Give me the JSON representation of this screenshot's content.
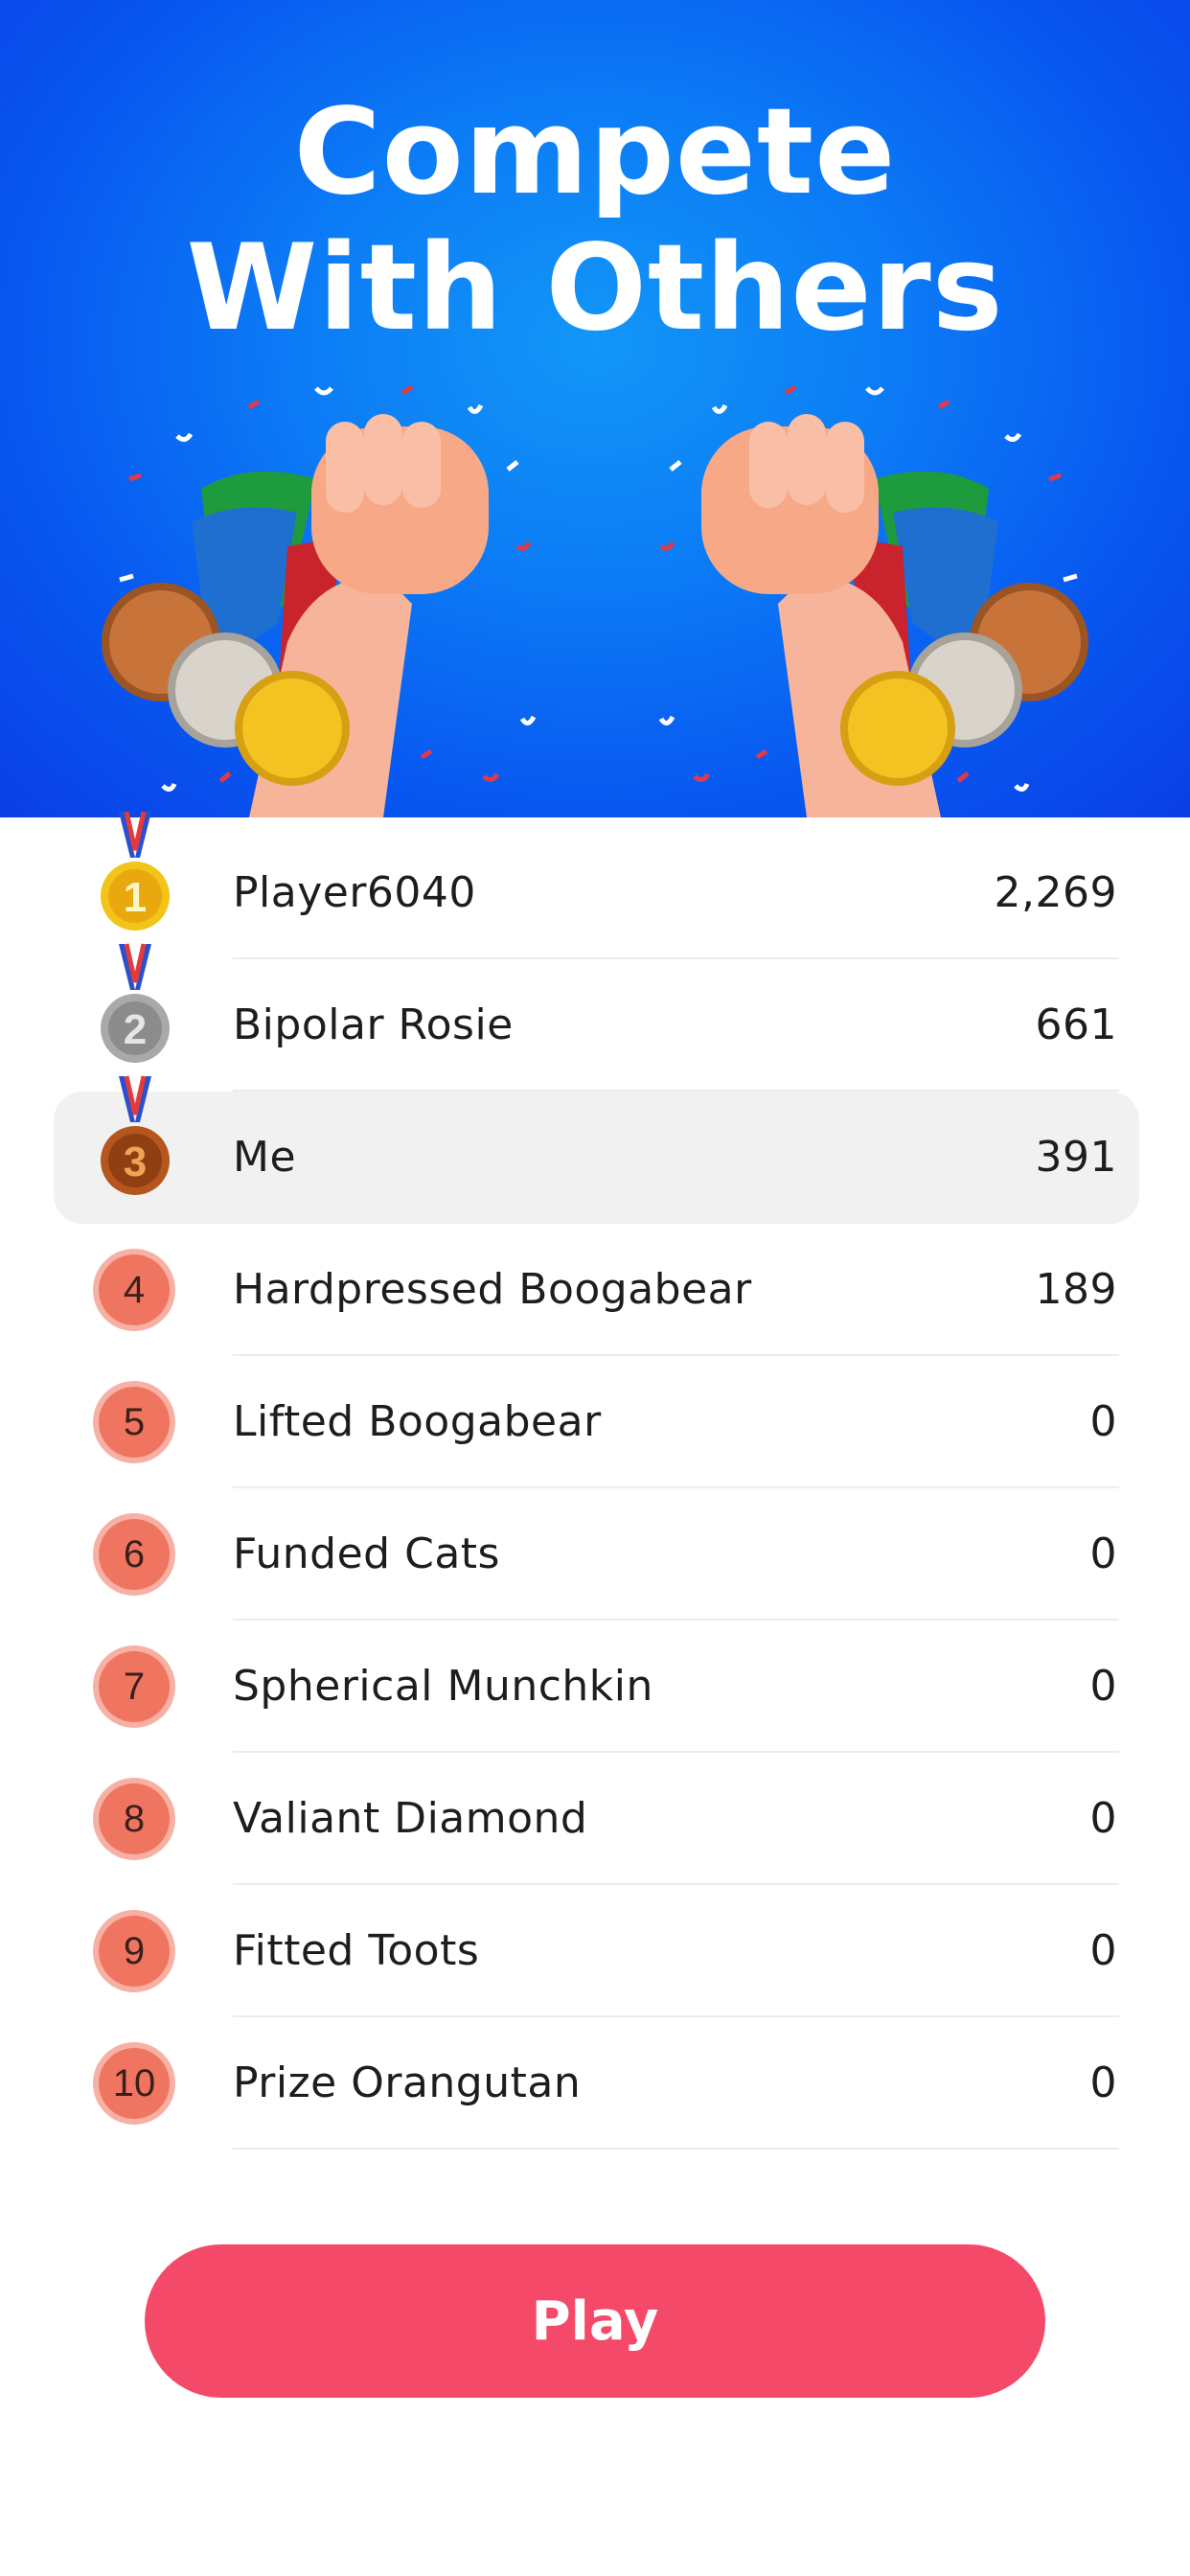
{
  "hero": {
    "title_line1": "Compete",
    "title_line2": "With Others"
  },
  "leaderboard": {
    "rows": [
      {
        "rank": "1",
        "name": "Player6040",
        "score": "2,269",
        "medal": "gold"
      },
      {
        "rank": "2",
        "name": "Bipolar Rosie",
        "score": "661",
        "medal": "silver"
      },
      {
        "rank": "3",
        "name": "Me",
        "score": "391",
        "medal": "bronze",
        "highlighted": true
      },
      {
        "rank": "4",
        "name": "Hardpressed Boogabear",
        "score": "189"
      },
      {
        "rank": "5",
        "name": "Lifted Boogabear",
        "score": "0"
      },
      {
        "rank": "6",
        "name": "Funded Cats",
        "score": "0"
      },
      {
        "rank": "7",
        "name": "Spherical Munchkin",
        "score": "0"
      },
      {
        "rank": "8",
        "name": "Valiant Diamond",
        "score": "0"
      },
      {
        "rank": "9",
        "name": "Fitted Toots",
        "score": "0"
      },
      {
        "rank": "10",
        "name": "Prize Orangutan",
        "score": "0"
      }
    ]
  },
  "play_button": {
    "label": "Play"
  },
  "colors": {
    "hero_blue": "#0c7cf6",
    "play_button": "#f5496a",
    "rank_badge": "#f07561",
    "highlight_row": "#f1f1f2"
  }
}
